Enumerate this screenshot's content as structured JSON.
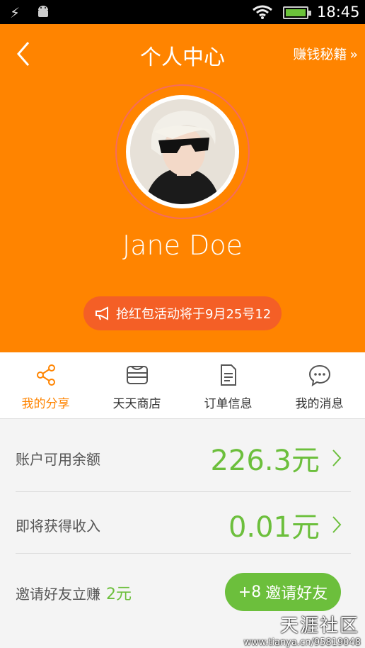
{
  "status_bar": {
    "time": "18:45"
  },
  "header": {
    "title": "个人中心",
    "tips_link": "赚钱秘籍",
    "tips_arrow": "»",
    "user_name": "Jane Doe",
    "promo_text": "抢红包活动将于9月25号12"
  },
  "tabs": [
    {
      "label": "我的分享",
      "icon": "share-icon",
      "active": true
    },
    {
      "label": "天天商店",
      "icon": "store-icon",
      "active": false
    },
    {
      "label": "订单信息",
      "icon": "document-icon",
      "active": false
    },
    {
      "label": "我的消息",
      "icon": "chat-icon",
      "active": false
    }
  ],
  "balance": {
    "label": "账户可用余额",
    "value": "226.3元"
  },
  "upcoming": {
    "label": "即将获得收入",
    "value": "0.01元"
  },
  "invite": {
    "label": "邀请好友立赚",
    "amount": "2元",
    "button": "邀请好友",
    "button_prefix": "+8"
  },
  "watermark": {
    "brand": "天涯社区",
    "url": "www.tianya.cn/95819048"
  },
  "colors": {
    "accent": "#ff8400",
    "green": "#6cbf3c",
    "pill": "#f45f26"
  }
}
